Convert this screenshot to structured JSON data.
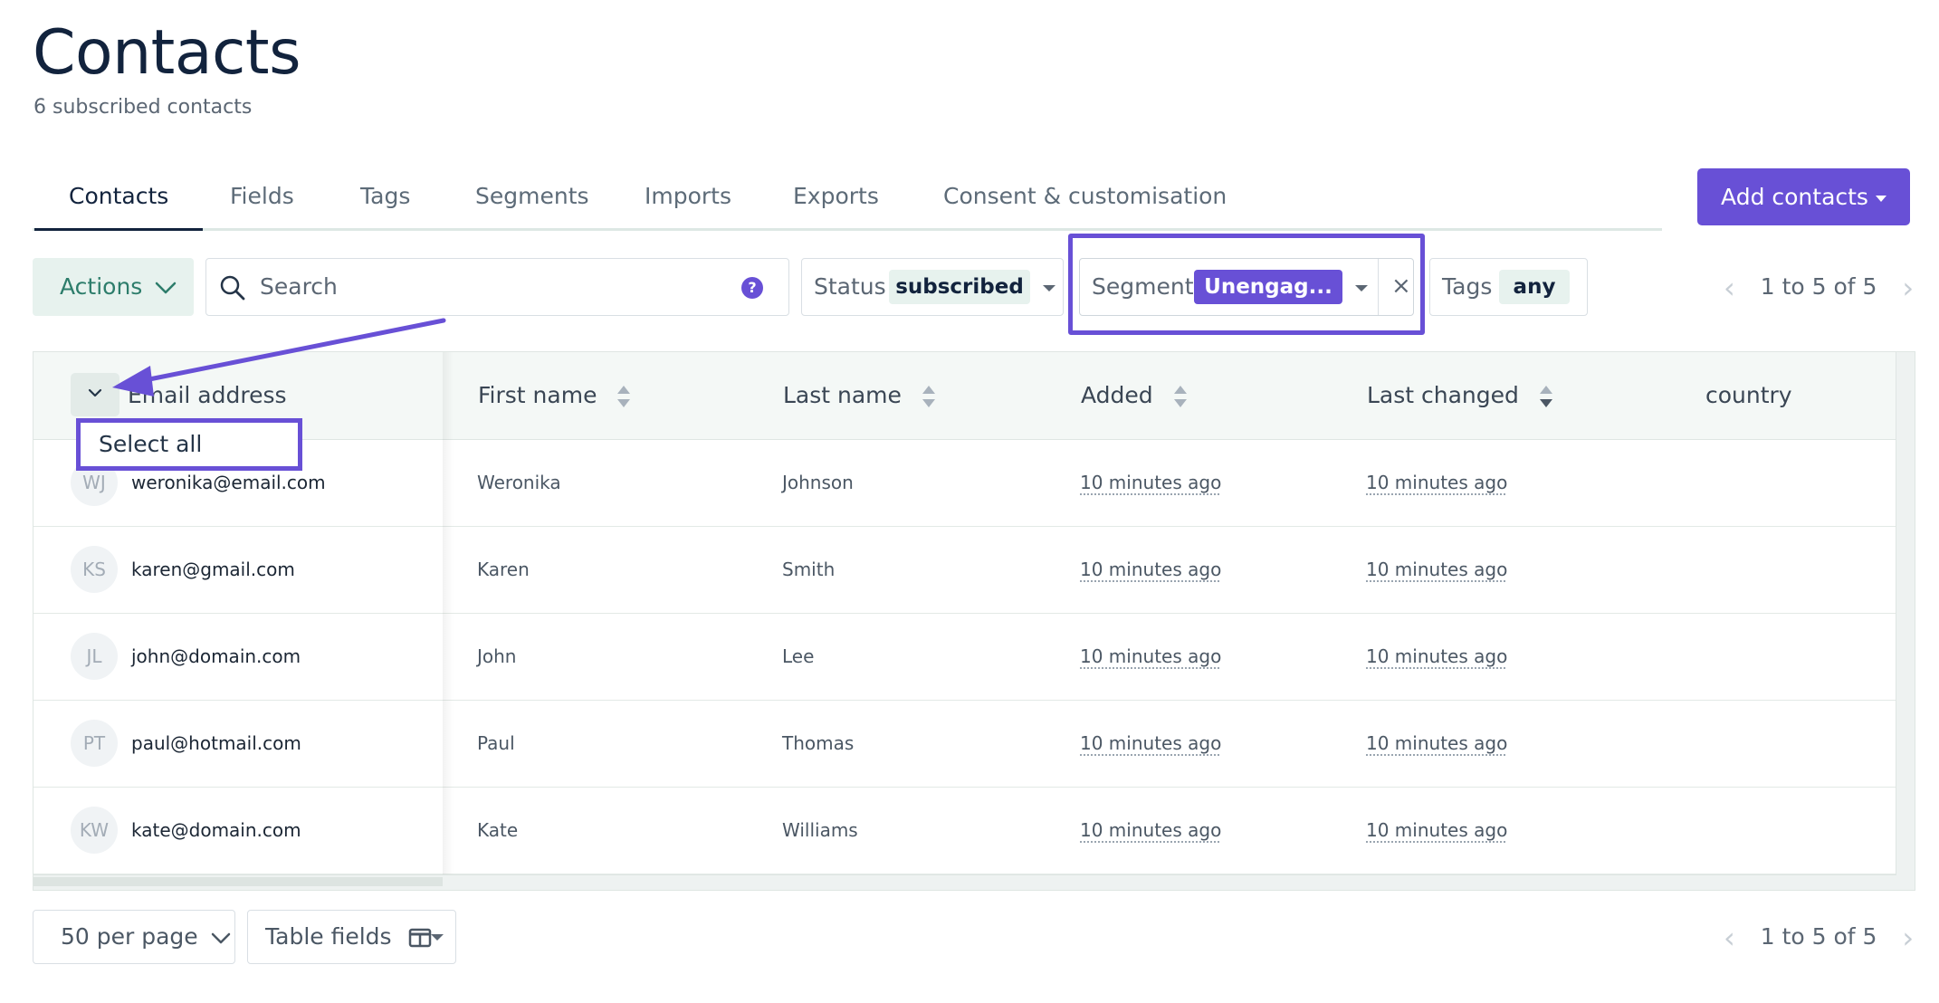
{
  "header": {
    "title": "Contacts",
    "subtitle": "6 subscribed contacts"
  },
  "tabs": [
    {
      "label": "Contacts",
      "active": true
    },
    {
      "label": "Fields"
    },
    {
      "label": "Tags"
    },
    {
      "label": "Segments"
    },
    {
      "label": "Imports"
    },
    {
      "label": "Exports"
    },
    {
      "label": "Consent & customisation"
    }
  ],
  "toolbar": {
    "add_contacts": "Add contacts",
    "actions": "Actions",
    "search_placeholder": "Search",
    "help": "?",
    "status_label": "Status",
    "status_value": "subscribed",
    "segment_label": "Segment",
    "segment_value": "Unengag...",
    "clear": "×",
    "tags_label": "Tags",
    "tags_value": "any",
    "pagination": "1 to 5 of 5"
  },
  "table": {
    "columns": [
      "Email address",
      "First name",
      "Last name",
      "Added",
      "Last changed",
      "country"
    ],
    "select_all": "Select all",
    "rows": [
      {
        "initials": "WJ",
        "email": "weronika@email.com",
        "first": "Weronika",
        "last": "Johnson",
        "added": "10 minutes ago",
        "changed": "10 minutes ago"
      },
      {
        "initials": "KS",
        "email": "karen@gmail.com",
        "first": "Karen",
        "last": "Smith",
        "added": "10 minutes ago",
        "changed": "10 minutes ago"
      },
      {
        "initials": "JL",
        "email": "john@domain.com",
        "first": "John",
        "last": "Lee",
        "added": "10 minutes ago",
        "changed": "10 minutes ago"
      },
      {
        "initials": "PT",
        "email": "paul@hotmail.com",
        "first": "Paul",
        "last": "Thomas",
        "added": "10 minutes ago",
        "changed": "10 minutes ago"
      },
      {
        "initials": "KW",
        "email": "kate@domain.com",
        "first": "Kate",
        "last": "Williams",
        "added": "10 minutes ago",
        "changed": "10 minutes ago"
      }
    ]
  },
  "footer": {
    "per_page": "50 per page",
    "table_fields": "Table fields",
    "pagination": "1 to 5 of 5"
  },
  "colors": {
    "accent": "#6850d6",
    "actions_bg": "#e7f2ee",
    "actions_text": "#2d7d6b",
    "heading": "#12233d"
  }
}
